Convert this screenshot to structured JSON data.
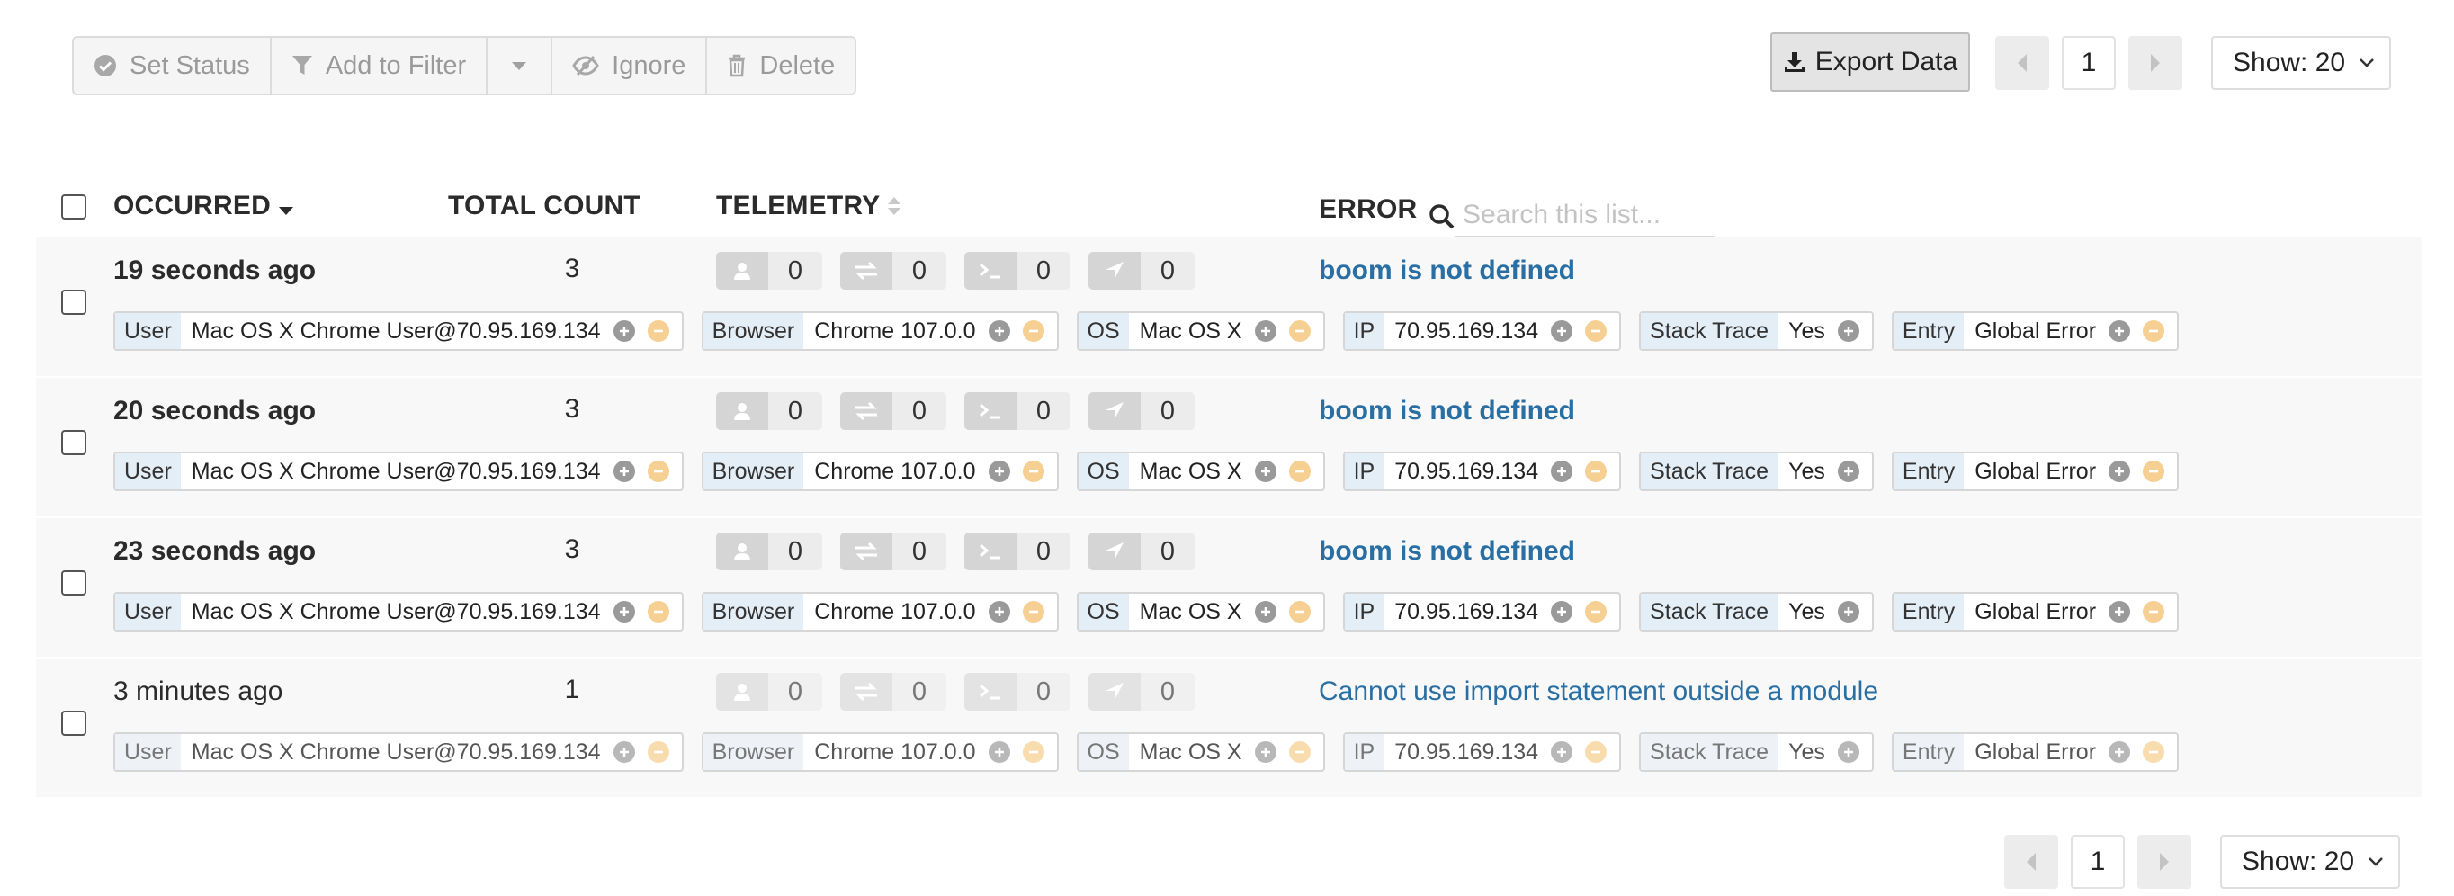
{
  "toolbar": {
    "set_status": "Set Status",
    "add_to_filter": "Add to Filter",
    "ignore": "Ignore",
    "delete": "Delete",
    "export": "Export Data"
  },
  "pager_top": {
    "page": "1",
    "show": "Show: 20"
  },
  "pager_bottom": {
    "page": "1",
    "show": "Show: 20"
  },
  "table": {
    "headers": {
      "occurred": "OCCURRED",
      "total_count": "TOTAL COUNT",
      "telemetry": "TELEMETRY",
      "error": "ERROR"
    },
    "search_placeholder": "Search this list...",
    "rows": [
      {
        "occurred": "19 seconds ago",
        "count": "3",
        "telemetry": [
          "0",
          "0",
          "0",
          "0"
        ],
        "error": "boom is not defined",
        "tags": [
          {
            "k": "User",
            "v": "Mac OS X Chrome User@70.95.169.134"
          },
          {
            "k": "Browser",
            "v": "Chrome 107.0.0"
          },
          {
            "k": "OS",
            "v": "Mac OS X"
          },
          {
            "k": "IP",
            "v": "70.95.169.134"
          },
          {
            "k": "Stack Trace",
            "v": "Yes"
          },
          {
            "k": "Entry",
            "v": "Global Error"
          }
        ]
      },
      {
        "occurred": "20 seconds ago",
        "count": "3",
        "telemetry": [
          "0",
          "0",
          "0",
          "0"
        ],
        "error": "boom is not defined",
        "tags": [
          {
            "k": "User",
            "v": "Mac OS X Chrome User@70.95.169.134"
          },
          {
            "k": "Browser",
            "v": "Chrome 107.0.0"
          },
          {
            "k": "OS",
            "v": "Mac OS X"
          },
          {
            "k": "IP",
            "v": "70.95.169.134"
          },
          {
            "k": "Stack Trace",
            "v": "Yes"
          },
          {
            "k": "Entry",
            "v": "Global Error"
          }
        ]
      },
      {
        "occurred": "23 seconds ago",
        "count": "3",
        "telemetry": [
          "0",
          "0",
          "0",
          "0"
        ],
        "error": "boom is not defined",
        "tags": [
          {
            "k": "User",
            "v": "Mac OS X Chrome User@70.95.169.134"
          },
          {
            "k": "Browser",
            "v": "Chrome 107.0.0"
          },
          {
            "k": "OS",
            "v": "Mac OS X"
          },
          {
            "k": "IP",
            "v": "70.95.169.134"
          },
          {
            "k": "Stack Trace",
            "v": "Yes"
          },
          {
            "k": "Entry",
            "v": "Global Error"
          }
        ]
      },
      {
        "occurred": "3 minutes ago",
        "count": "1",
        "telemetry": [
          "0",
          "0",
          "0",
          "0"
        ],
        "error": "Cannot use import statement outside a module",
        "tags": [
          {
            "k": "User",
            "v": "Mac OS X Chrome User@70.95.169.134"
          },
          {
            "k": "Browser",
            "v": "Chrome 107.0.0"
          },
          {
            "k": "OS",
            "v": "Mac OS X"
          },
          {
            "k": "IP",
            "v": "70.95.169.134"
          },
          {
            "k": "Stack Trace",
            "v": "Yes"
          },
          {
            "k": "Entry",
            "v": "Global Error"
          }
        ]
      }
    ]
  },
  "colors": {
    "link": "#2a6fa3",
    "row_bg": "#f8f8f8",
    "tag_key_bg": "#e4eef6",
    "minus_icon": "#f6cf93"
  }
}
